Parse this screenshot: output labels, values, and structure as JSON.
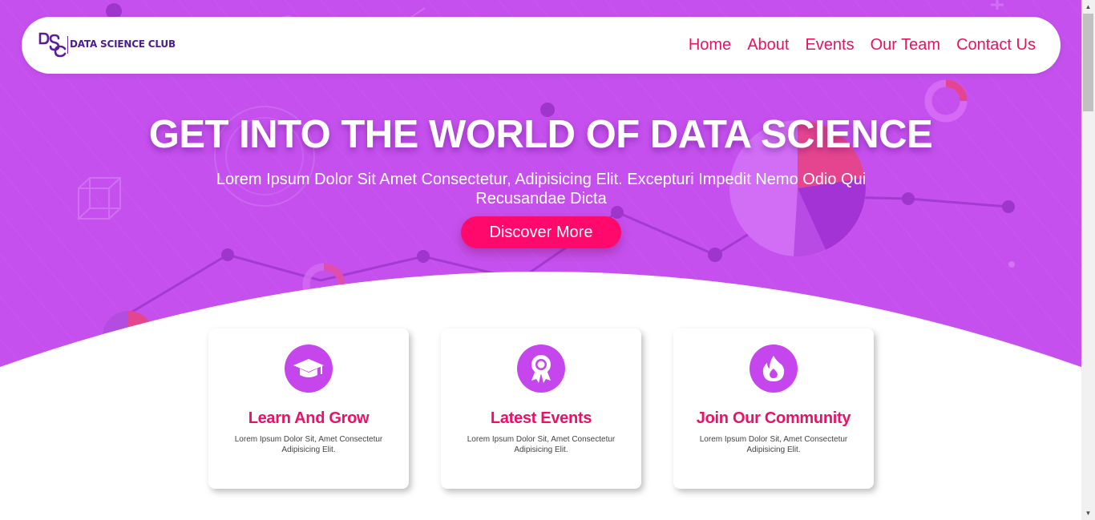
{
  "brand": {
    "name": "DATA SCIENCE CLUB",
    "mark": "DSC"
  },
  "nav": {
    "items": [
      "Home",
      "About",
      "Events",
      "Our Team",
      "Contact Us"
    ]
  },
  "hero": {
    "title": "GET INTO THE WORLD OF DATA SCIENCE",
    "subtitle": "Lorem Ipsum Dolor Sit Amet Consectetur, Adipisicing Elit. Excepturi Impedit Nemo Odio Qui Recusandae Dicta",
    "cta": "Discover More"
  },
  "cards": [
    {
      "icon": "graduation-cap-icon",
      "title": "Learn And Grow",
      "desc": "Lorem Ipsum Dolor Sit, Amet Consectetur Adipisicing Elit."
    },
    {
      "icon": "award-badge-icon",
      "title": "Latest Events",
      "desc": "Lorem Ipsum Dolor Sit, Amet Consectetur Adipisicing Elit."
    },
    {
      "icon": "fire-icon",
      "title": "Join Our Community",
      "desc": "Lorem Ipsum Dolor Sit, Amet Consectetur Adipisicing Elit."
    }
  ],
  "colors": {
    "hero_bg": "#c550ee",
    "accent": "#ff0a6c",
    "nav_link": "#e8125e",
    "card_icon_bg": "#c546ec",
    "logo": "#4b1d8f"
  }
}
